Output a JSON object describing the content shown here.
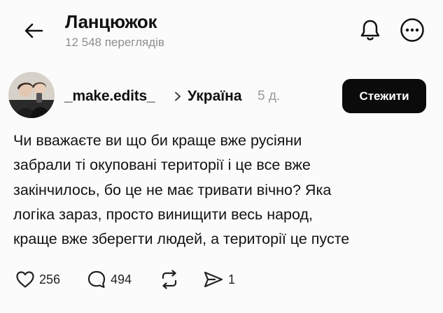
{
  "header": {
    "title": "Ланцюжок",
    "views": "12 548 переглядів"
  },
  "post": {
    "username": "_make.edits_",
    "location": "Україна",
    "time": "5 д.",
    "follow_label": "Стежити",
    "text_lines": [
      "Чи вважаєте ви що би краще вже русіяни",
      "забрали ті окуповані території і це все вже",
      "закінчилось, бо це не має тривати вічно? Яка",
      "логіка зараз, просто винищити весь народ,",
      "краще вже зберегти людей, а території це пусте"
    ]
  },
  "actions": {
    "likes": "256",
    "comments": "494",
    "shares": "1"
  },
  "colors": {
    "background": "#fbfbfb",
    "button_bg": "#0b0b0b",
    "muted_text": "#8e8e8e"
  },
  "icons": [
    "back-arrow-icon",
    "bell-icon",
    "more-icon",
    "chevron-right-icon",
    "heart-icon",
    "comment-icon",
    "repost-icon",
    "send-icon"
  ]
}
